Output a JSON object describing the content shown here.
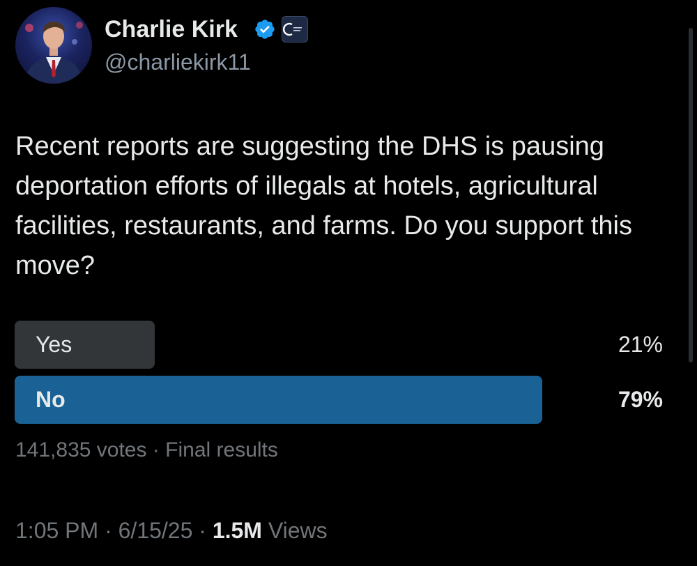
{
  "author": {
    "name": "Charlie Kirk",
    "handle": "@charliekirk11",
    "verified_color": "#1d9bf0"
  },
  "tweet": {
    "text": "Recent reports are suggesting the DHS is pausing deportation efforts of illegals at hotels, agricultural facilities, restaurants, and farms. Do you support this move?"
  },
  "poll": {
    "options": [
      {
        "label": "Yes",
        "percent_text": "21%",
        "percent": 21,
        "winner": false,
        "bar_color": "#333639"
      },
      {
        "label": "No",
        "percent_text": "79%",
        "percent": 79,
        "winner": true,
        "bar_color": "#1a6296"
      }
    ],
    "votes": "141,835 votes",
    "separator": "·",
    "status": "Final results"
  },
  "footer": {
    "time": "1:05 PM",
    "date": "6/15/25",
    "separator": "·",
    "views_count": "1.5M",
    "views_label": "Views"
  },
  "icons": {
    "verified": "verified-check-icon",
    "org_badge": "organization-badge-icon"
  }
}
